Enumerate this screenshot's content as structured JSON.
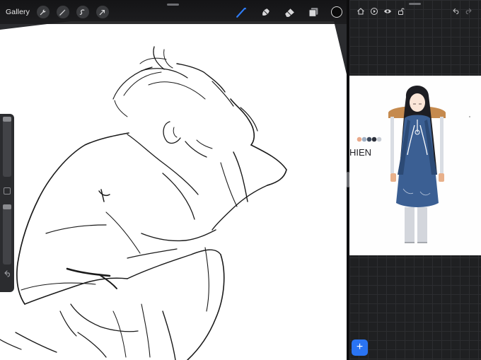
{
  "procreate": {
    "gallery_label": "Gallery",
    "toolbar_left": [
      "wrench-icon",
      "magic-wand-icon",
      "selection-icon",
      "transform-arrow-icon"
    ],
    "toolbar_right": [
      "brush-icon",
      "smudge-icon",
      "eraser-icon",
      "layers-icon"
    ],
    "active_tool": "brush",
    "active_tool_color": "#2f7cf6",
    "current_color": "#0a0a0a"
  },
  "reference": {
    "toolbar_left": [
      "home-icon",
      "play-icon",
      "eye-icon",
      "unlock-icon"
    ],
    "toolbar_right": [
      "undo-icon",
      "redo-icon"
    ],
    "image_text": "HIEN",
    "palette": [
      "#e9a98a",
      "#9fb0c4",
      "#3f4a5c",
      "#2b2f3a",
      "#c7ccd4"
    ],
    "add_label": "+"
  }
}
